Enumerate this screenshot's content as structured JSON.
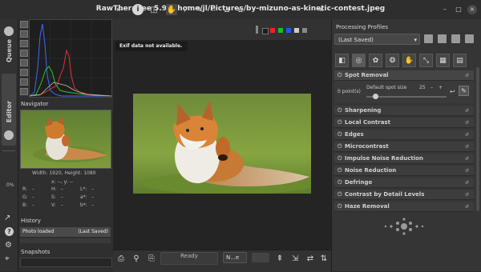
{
  "window": {
    "title": "RawTherapee 5.9 - /home/jl/Pictures/by-mizuno-as-kinetic-contest.jpeg",
    "minimize": "–",
    "maximize": "□",
    "close": "×"
  },
  "left_tabs": {
    "queue": "Queue",
    "editor": "Editor",
    "zoom": "0%"
  },
  "navigator": {
    "title": "Navigator",
    "dims": "Width: 1920, Height: 1080",
    "coords": "x: --, y: --",
    "readouts": [
      {
        "a": "R:",
        "av": "–",
        "b": "H:",
        "bv": "–",
        "c": "L*:",
        "cv": "–"
      },
      {
        "a": "G:",
        "av": "–",
        "b": "S:",
        "bv": "–",
        "c": "a*:",
        "cv": "–"
      },
      {
        "a": "B:",
        "av": "–",
        "b": "V:",
        "bv": "–",
        "c": "b*:",
        "cv": "–"
      }
    ]
  },
  "history": {
    "title": "History",
    "entry": "Photo loaded",
    "entry_right": "(Last Saved)"
  },
  "snapshots": {
    "title": "Snapshots"
  },
  "viewer": {
    "info_message": "Exif data not available.",
    "status": "Ready",
    "zoom_select": "N...e"
  },
  "processing": {
    "title": "Processing Profiles",
    "profile": "(Last Saved)"
  },
  "spot_removal": {
    "title": "Spot Removal",
    "points": "0 point(s)",
    "spot_size_label": "Default spot size",
    "spot_size_value": "25",
    "spot_size_min": "–",
    "spot_size_plus": "+"
  },
  "tools": [
    "Sharpening",
    "Local Contrast",
    "Edges",
    "Microcontrast",
    "Impulse Noise Reduction",
    "Noise Reduction",
    "Defringe",
    "Contrast by Detail Levels",
    "Haze Removal"
  ]
}
